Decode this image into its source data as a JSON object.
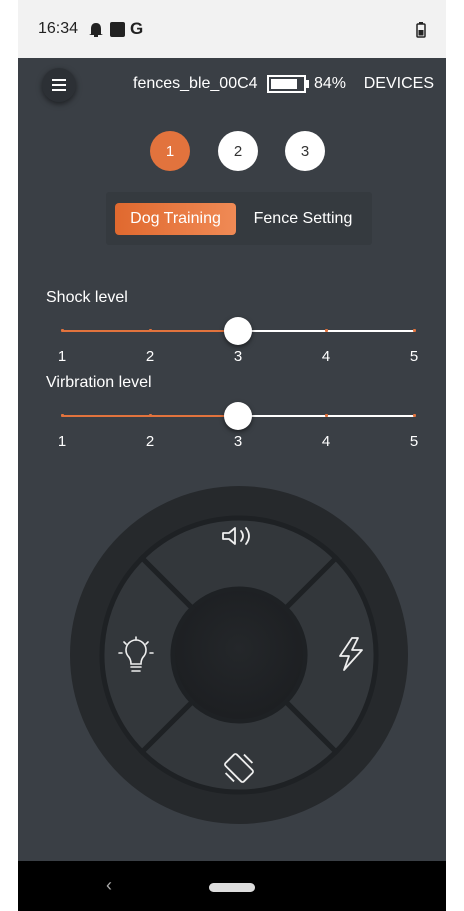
{
  "status_bar": {
    "time": "16:34",
    "icons": [
      "ghost-notification-icon",
      "square-notification-icon",
      "google-g-icon",
      "battery-icon"
    ],
    "google_letter": "G"
  },
  "app_bar": {
    "menu_icon": "hamburger-icon",
    "device_name": "fences_ble_00C4",
    "battery_percent": "84%",
    "battery_level": 0.84,
    "devices_label": "DEVICES"
  },
  "channels": [
    {
      "label": "1",
      "active": true
    },
    {
      "label": "2",
      "active": false
    },
    {
      "label": "3",
      "active": false
    }
  ],
  "mode_tabs": {
    "active": "Dog Training",
    "inactive": "Fence Setting"
  },
  "sliders": [
    {
      "label": "Shock level",
      "min": 1,
      "max": 5,
      "value": 3,
      "ticks": [
        "1",
        "2",
        "3",
        "4",
        "5"
      ]
    },
    {
      "label": "Virbration level",
      "min": 1,
      "max": 5,
      "value": 3,
      "ticks": [
        "1",
        "2",
        "3",
        "4",
        "5"
      ]
    }
  ],
  "controller": {
    "top": "sound-icon",
    "left": "light-bulb-icon",
    "right": "lightning-icon",
    "bottom": "vibration-icon"
  },
  "nav_bar": {
    "back": "‹"
  },
  "colors": {
    "accent": "#e2733d",
    "background": "#3a3f45",
    "pad_ring": "#26292c",
    "pad_button": "#33373b",
    "pad_center": "#202326"
  }
}
